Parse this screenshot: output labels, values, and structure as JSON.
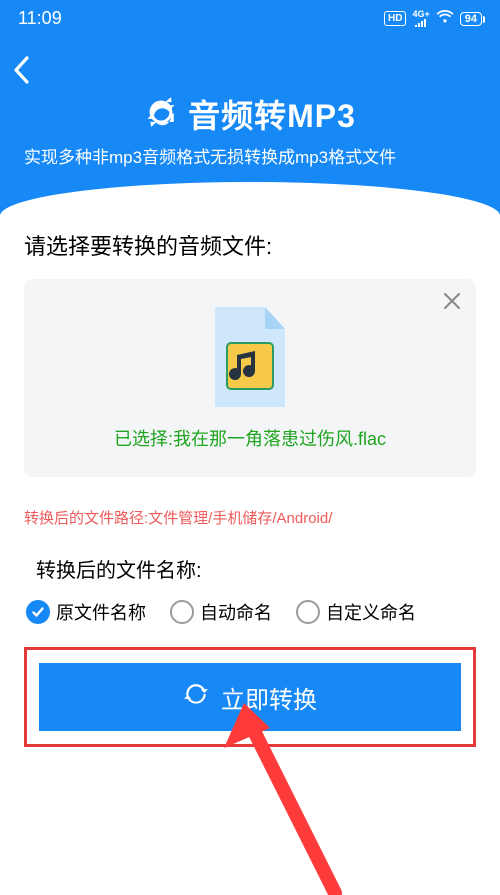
{
  "status": {
    "time": "11:09",
    "hd": "HD",
    "network": "4G+",
    "battery": "94"
  },
  "header": {
    "title": "音频转MP3",
    "subtitle": "实现多种非mp3音频格式无损转换成mp3格式文件"
  },
  "main": {
    "select_label": "请选择要转换的音频文件:",
    "selected_prefix": "已选择:",
    "selected_file": "我在那一角落患过伤风.flac",
    "output_path_label": "转换后的文件路径:",
    "output_path_value": "文件管理/手机储存/Android/",
    "name_label": "转换后的文件名称:",
    "radios": {
      "original": "原文件名称",
      "auto": "自动命名",
      "custom": "自定义命名"
    },
    "convert_button": "立即转换"
  },
  "icons": {
    "refresh": "refresh-icon",
    "back": "chevron-left-icon",
    "close": "close-icon",
    "music": "music-file-icon"
  }
}
